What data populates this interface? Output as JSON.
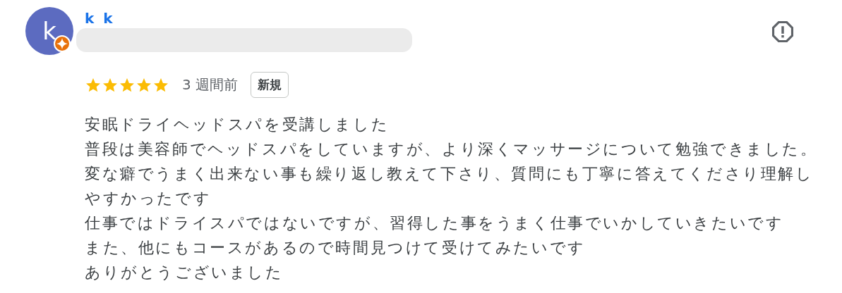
{
  "review": {
    "avatar_letter": "k",
    "name": "k k",
    "stars": 5,
    "time": "3 週間前",
    "badge": "新規",
    "body": [
      "安眠ドライヘッドスパを受講しました",
      "普段は美容師でヘッドスパをしていますが、より深くマッサージについて勉強できました。",
      "変な癖でうまく出来ない事も繰り返し教えて下さり、質問にも丁寧に答えてくださり理解しやすかったです",
      "仕事ではドライスパではないですが、習得した事をうまく仕事でいかしていきたいです",
      "また、他にもコースがあるので時間見つけて受けてみたいです",
      "ありがとうございました"
    ]
  }
}
